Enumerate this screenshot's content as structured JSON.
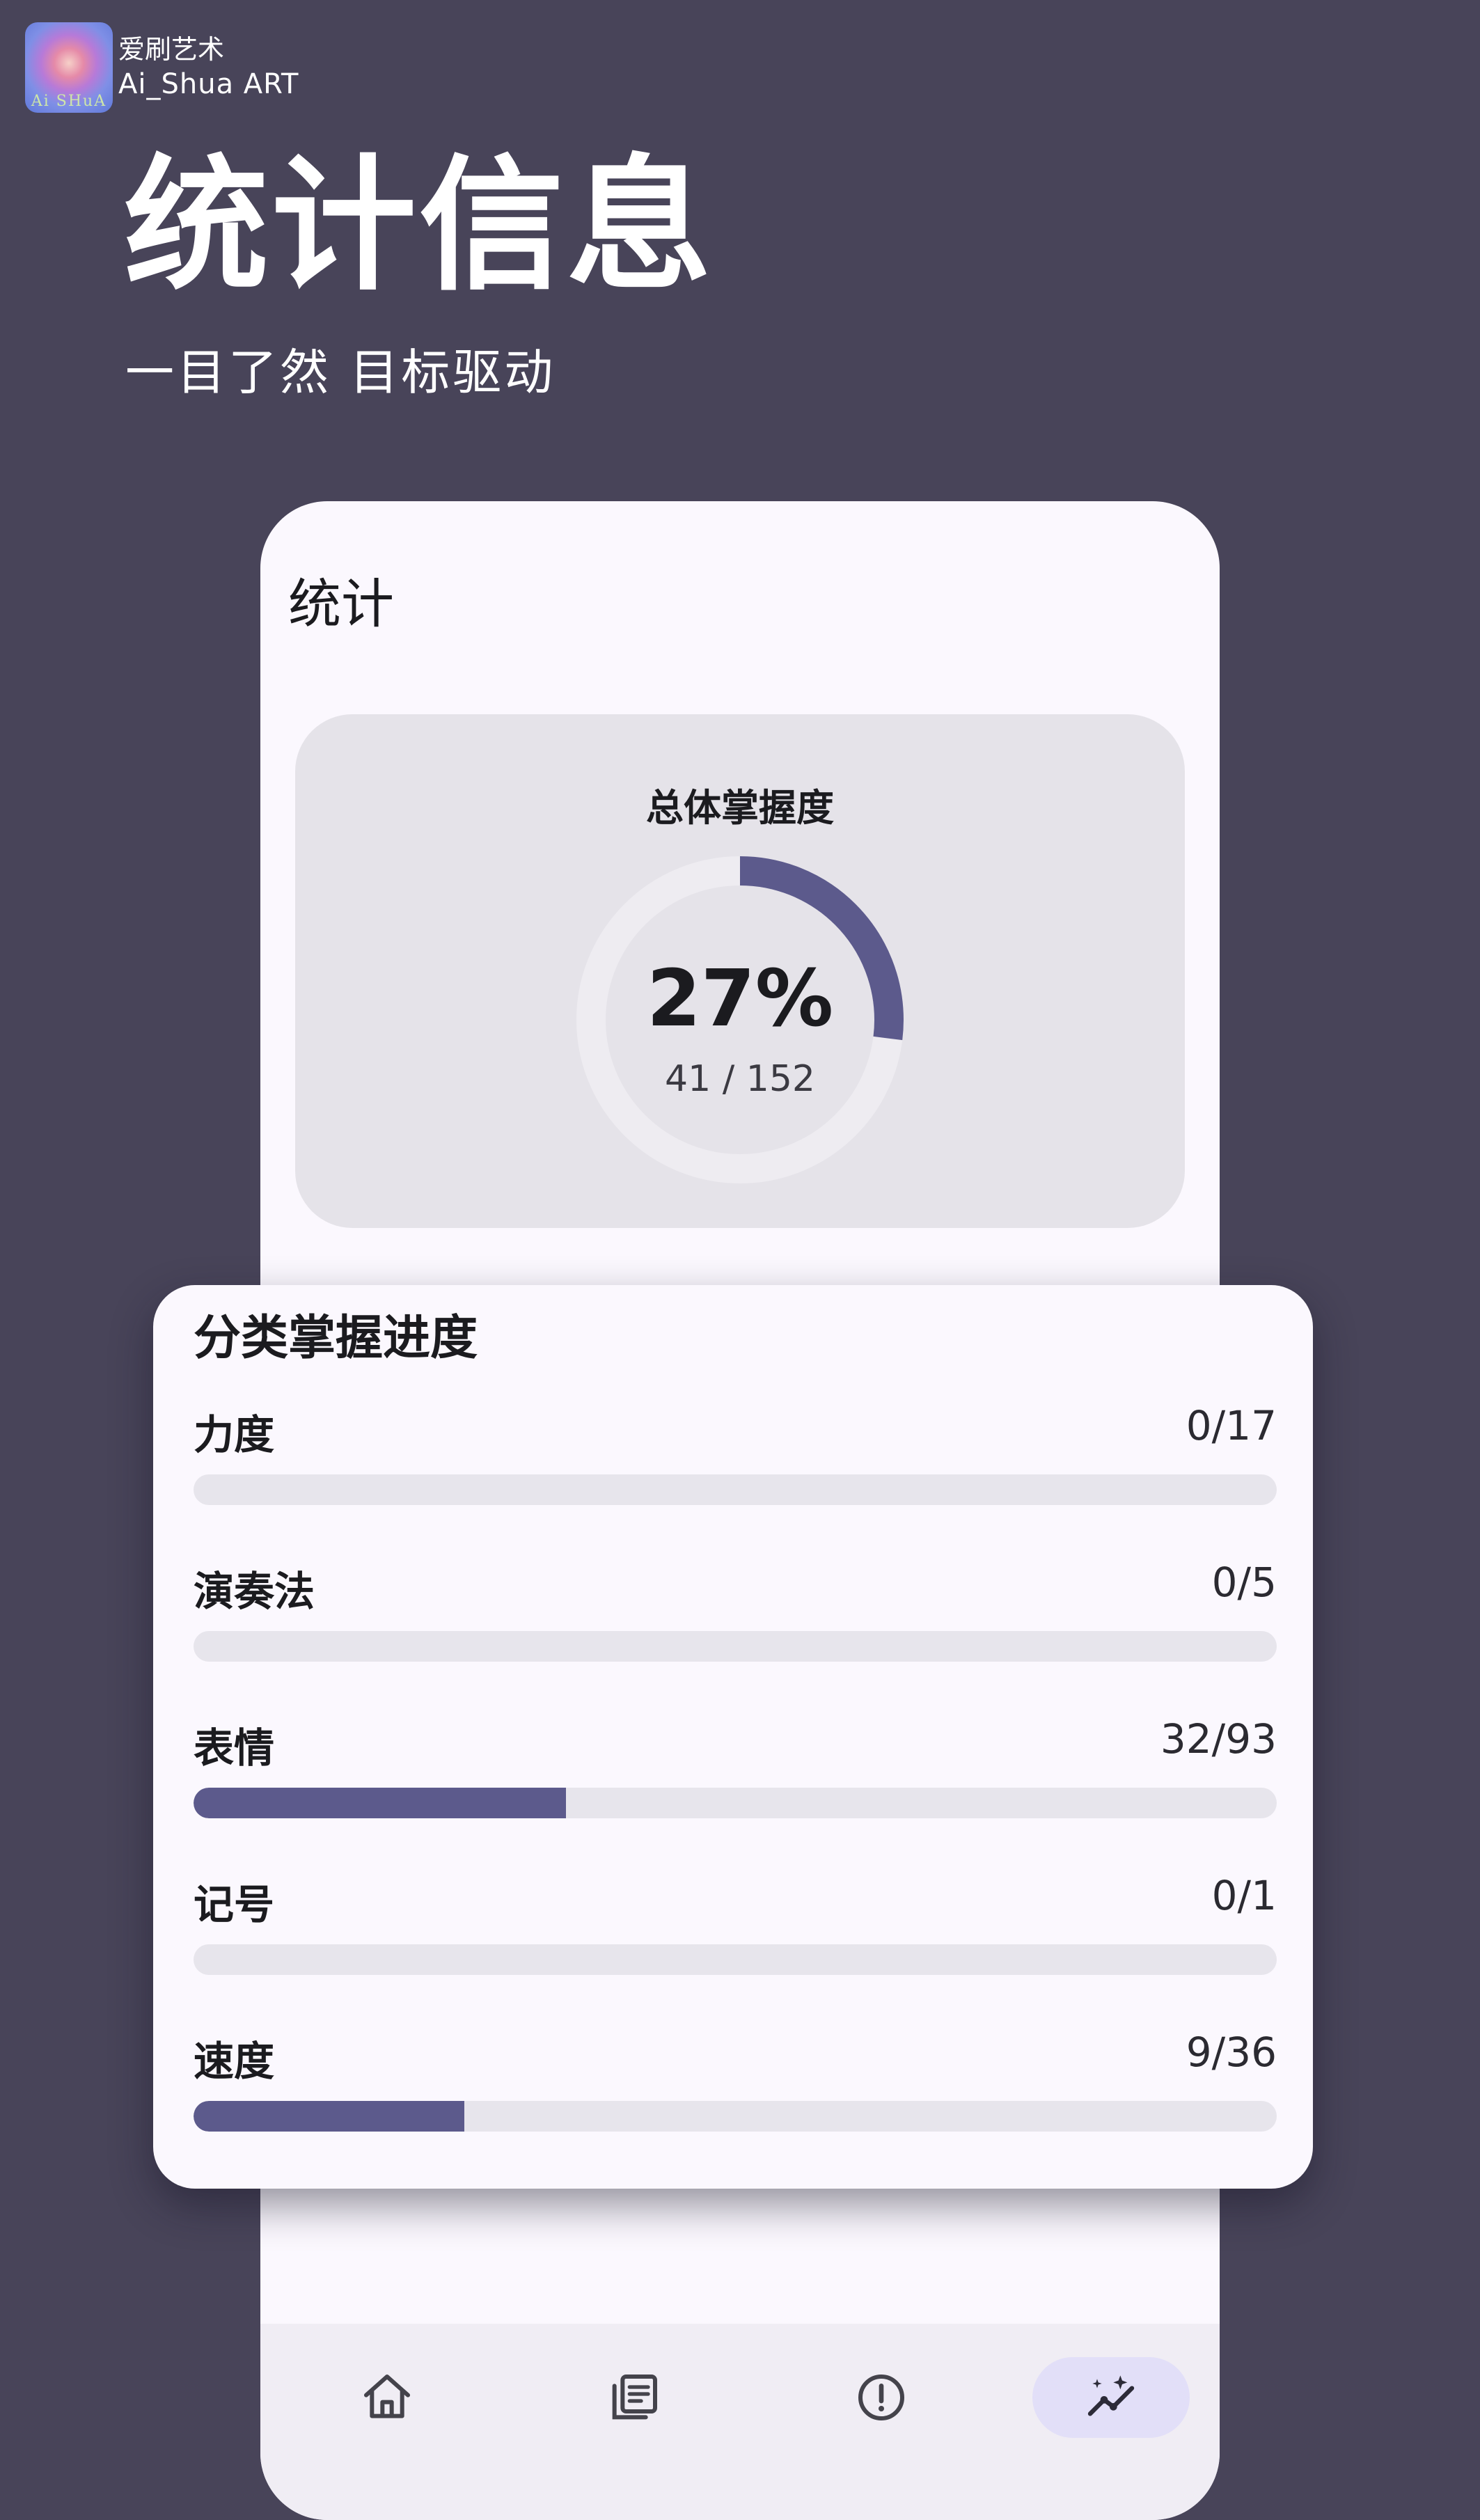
{
  "brand": {
    "name_cn": "爱刷艺术",
    "name_en": "Ai_Shua ART",
    "logo_text": "Ai SHuA"
  },
  "hero": {
    "title": "统计信息",
    "subtitle": "一目了然 目标驱动"
  },
  "screen": {
    "title": "统计",
    "overall": {
      "title": "总体掌握度",
      "percent_label": "27%",
      "count_label": "41 / 152",
      "mastered": 41,
      "total": 152
    },
    "categories_title": "分类掌握进度",
    "categories": [
      {
        "name": "力度",
        "count_label": "0/17",
        "done": 0,
        "total": 17
      },
      {
        "name": "演奏法",
        "count_label": "0/5",
        "done": 0,
        "total": 5
      },
      {
        "name": "表情",
        "count_label": "32/93",
        "done": 32,
        "total": 93
      },
      {
        "name": "记号",
        "count_label": "0/1",
        "done": 0,
        "total": 1
      },
      {
        "name": "速度",
        "count_label": "9/36",
        "done": 9,
        "total": 36
      }
    ],
    "nav": [
      {
        "icon": "home-icon",
        "active": false
      },
      {
        "icon": "library-icon",
        "active": false
      },
      {
        "icon": "alert-circle-icon",
        "active": false
      },
      {
        "icon": "stats-sparkle-icon",
        "active": true
      }
    ]
  },
  "colors": {
    "background": "#484459",
    "accent": "#5c5a8c",
    "track": "#e7e5ec",
    "card": "#fbf8fe",
    "nav_active": "#e2dff8"
  }
}
